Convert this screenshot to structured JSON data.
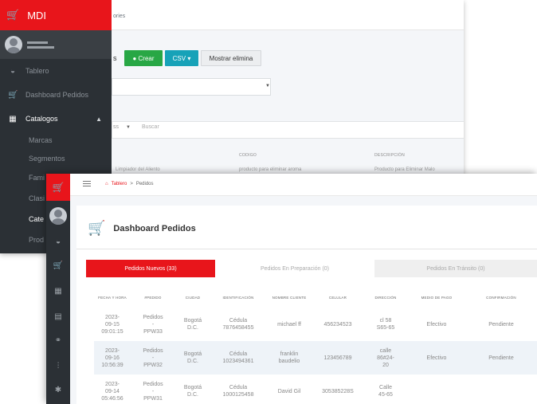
{
  "back": {
    "brand": "MDI",
    "breadcrumb": "ories",
    "sidebar": [
      {
        "label": "Tablero",
        "icon": "dashboard-icon"
      },
      {
        "label": "Dashboard Pedidos",
        "icon": "cart-icon"
      },
      {
        "label": "Catalogos",
        "icon": "catalog-icon"
      }
    ],
    "subitems": [
      "Marcas",
      "Segmentos",
      "Fami",
      "Clasi",
      "Cate",
      "Prod"
    ],
    "section_label": "s",
    "buttons": {
      "create": "● Crear",
      "csv": "CSV ▾",
      "show_deleted": "Mostrar elimina"
    },
    "length_select": "ss",
    "search_placeholder": "Buscar",
    "columns": [
      "CODIGO",
      "DESCRIPCIÓN"
    ],
    "row": [
      "Limpiador del Aliento",
      "producto para eliminar aroma",
      "Producto para Eliminar Malo"
    ]
  },
  "front": {
    "breadcrumb": {
      "home": "Tablero",
      "sep": ">",
      "current": "Pedidos"
    },
    "title": "Dashboard Pedidos",
    "tabs": [
      {
        "label": "Pedidos Nuevos (33)",
        "active": true
      },
      {
        "label": "Pedidos En Preparación (0)",
        "active": false
      },
      {
        "label": "Pedidos En Tránsito (0)",
        "active": false
      }
    ],
    "columns": [
      "FECHA Y HORA",
      "#PEDIDO",
      "CIUDAD",
      "IDENTIFICACIÓN",
      "NOMBRE CLIENTE",
      "CELULAR",
      "DIRECCIÓN",
      "MEDIO DE PAGO",
      "CONFIRMACIÓN"
    ],
    "rows": [
      {
        "fecha": [
          "2023-",
          "09-15",
          "09:01:15"
        ],
        "pedido": [
          "Pedidos",
          "-",
          "PPW33"
        ],
        "ciudad": [
          "Bogotá",
          "D.C."
        ],
        "identificacion": [
          "Cédula",
          "7876458455"
        ],
        "nombre": [
          "michael ff"
        ],
        "celular": "456234523",
        "direccion": [
          "cl 58",
          "S65-65"
        ],
        "pago": "Efectivo",
        "confirmacion": "Pendiente"
      },
      {
        "fecha": [
          "2023-",
          "09-16",
          "10:56:39"
        ],
        "pedido": [
          "Pedidos",
          "-",
          "PPW32"
        ],
        "ciudad": [
          "Bogotá",
          "D.C."
        ],
        "identificacion": [
          "Cédula",
          "1023494361"
        ],
        "nombre": [
          "franklin",
          "baudelio"
        ],
        "celular": "123456789",
        "direccion": [
          "calle",
          "86#24-",
          "20"
        ],
        "pago": "Efectivo",
        "confirmacion": "Pendiente"
      },
      {
        "fecha": [
          "2023-",
          "09-14",
          "05:46:56"
        ],
        "pedido": [
          "Pedidos",
          "-",
          "PPW31"
        ],
        "ciudad": [
          "Bogotá",
          "D.C."
        ],
        "identificacion": [
          "Cédula",
          "1000125458"
        ],
        "nombre": [
          "David Gil"
        ],
        "celular": "305385228S",
        "direccion": [
          "Calle",
          "45-65"
        ],
        "pago": "",
        "confirmacion": ""
      }
    ]
  }
}
